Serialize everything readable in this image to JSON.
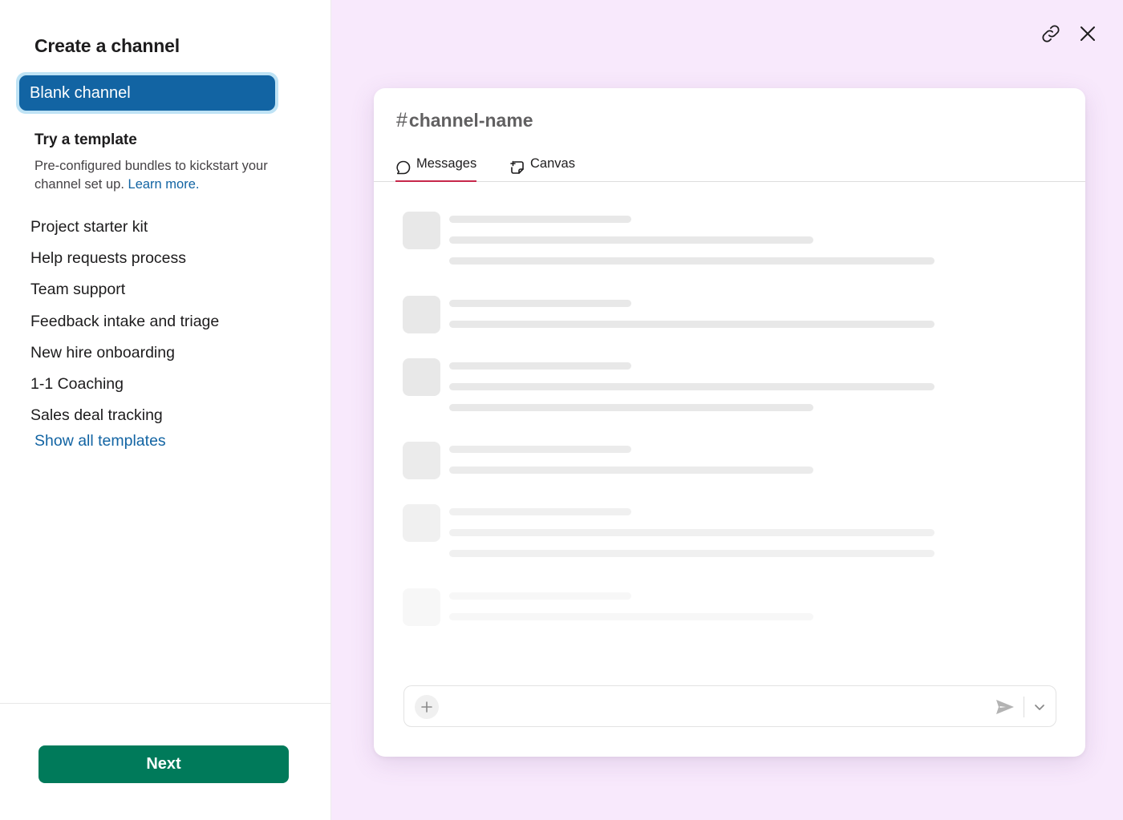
{
  "sidebar": {
    "title": "Create a channel",
    "blank_channel_label": "Blank channel",
    "template_section": {
      "heading": "Try a template",
      "description": "Pre-configured bundles to kickstart your channel set up.",
      "learn_more": "Learn more."
    },
    "templates": [
      "Project starter kit",
      "Help requests process",
      "Team support",
      "Feedback intake and triage",
      "New hire onboarding",
      "1-1 Coaching",
      "Sales deal tracking"
    ],
    "show_all": "Show all templates",
    "next_label": "Next"
  },
  "preview": {
    "hash": "#",
    "channel_name": "channel-name",
    "tabs": [
      {
        "label": "Messages",
        "icon": "message-bubble-icon",
        "active": true
      },
      {
        "label": "Canvas",
        "icon": "canvas-icon",
        "active": false
      }
    ],
    "header_icons": [
      "copy-link-icon",
      "close-icon"
    ],
    "composer_icons": [
      "plus-icon",
      "send-icon",
      "chevron-down-icon"
    ]
  },
  "colors": {
    "accent_blue": "#1264a3",
    "selection_ring": "#bfe3f5",
    "next_green": "#007a5a",
    "active_tab": "#c7274a",
    "preview_bg": "#f8e9fc",
    "skeleton": "#e8e8e8"
  }
}
